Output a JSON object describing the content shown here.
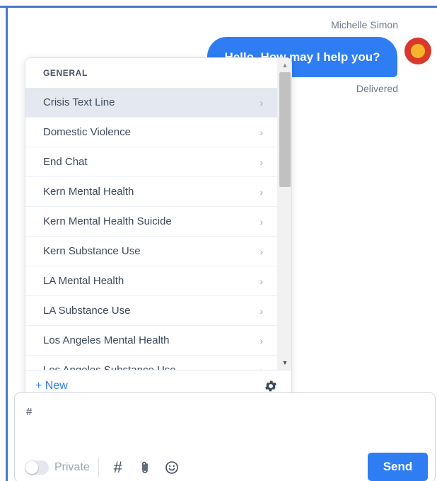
{
  "conversation": {
    "sender_name": "Michelle Simon",
    "message": "Hello, How may I help you?",
    "status": "Delivered"
  },
  "canned_popup": {
    "section": "GENERAL",
    "items": [
      {
        "label": "Crisis Text Line"
      },
      {
        "label": "Domestic Violence"
      },
      {
        "label": "End Chat"
      },
      {
        "label": "Kern Mental Health"
      },
      {
        "label": "Kern Mental Health Suicide"
      },
      {
        "label": "Kern Substance Use"
      },
      {
        "label": "LA Mental Health"
      },
      {
        "label": "LA Substance Use"
      },
      {
        "label": "Los Angeles Mental Health"
      },
      {
        "label": "Los Angeles Substance Use"
      }
    ],
    "chevron": "›",
    "new_label": "+ New",
    "settings_icon": "gear-icon"
  },
  "composer": {
    "value": "#",
    "private_label": "Private",
    "hash_symbol": "#",
    "send_label": "Send"
  },
  "colors": {
    "accent": "#2f7df2",
    "frame": "#4a78c8",
    "active_row": "#e3e9ee"
  }
}
